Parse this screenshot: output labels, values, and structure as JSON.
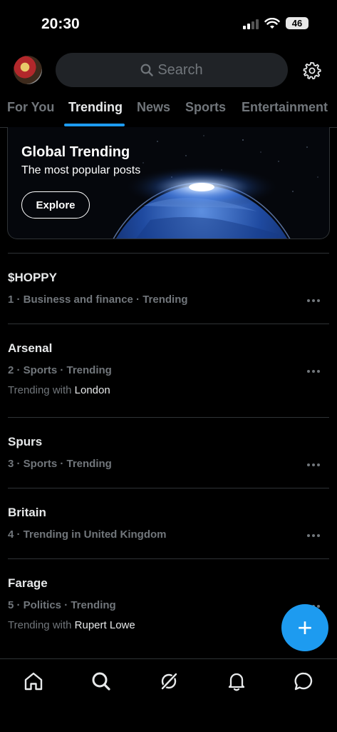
{
  "status_bar": {
    "time": "20:30",
    "battery": "46"
  },
  "search": {
    "placeholder": "Search"
  },
  "tabs": [
    {
      "label": "For You",
      "active": false
    },
    {
      "label": "Trending",
      "active": true
    },
    {
      "label": "News",
      "active": false
    },
    {
      "label": "Sports",
      "active": false
    },
    {
      "label": "Entertainment",
      "active": false
    }
  ],
  "hero": {
    "title": "Global Trending",
    "subtitle": "The most popular posts",
    "button_label": "Explore"
  },
  "trends": [
    {
      "name": "$HOPPY",
      "meta": "1 · Business and finance · Trending",
      "with_prefix": "",
      "with_name": ""
    },
    {
      "name": "Arsenal",
      "meta": "2 · Sports · Trending",
      "with_prefix": "Trending with ",
      "with_name": "London"
    },
    {
      "name": "Spurs",
      "meta": "3 · Sports · Trending",
      "with_prefix": "",
      "with_name": ""
    },
    {
      "name": "Britain",
      "meta": "4 · Trending in United Kingdom",
      "with_prefix": "",
      "with_name": ""
    },
    {
      "name": "Farage",
      "meta": "5 · Politics · Trending",
      "with_prefix": "Trending with ",
      "with_name": "Rupert Lowe"
    }
  ],
  "fab": {
    "icon": "+"
  },
  "nav": [
    {
      "icon": "home-icon"
    },
    {
      "icon": "search-icon"
    },
    {
      "icon": "grok-icon"
    },
    {
      "icon": "bell-icon"
    },
    {
      "icon": "messages-icon"
    }
  ],
  "colors": {
    "accent": "#1d9bf0",
    "background": "#000000",
    "muted": "#71767b",
    "divider": "#2f3336"
  }
}
